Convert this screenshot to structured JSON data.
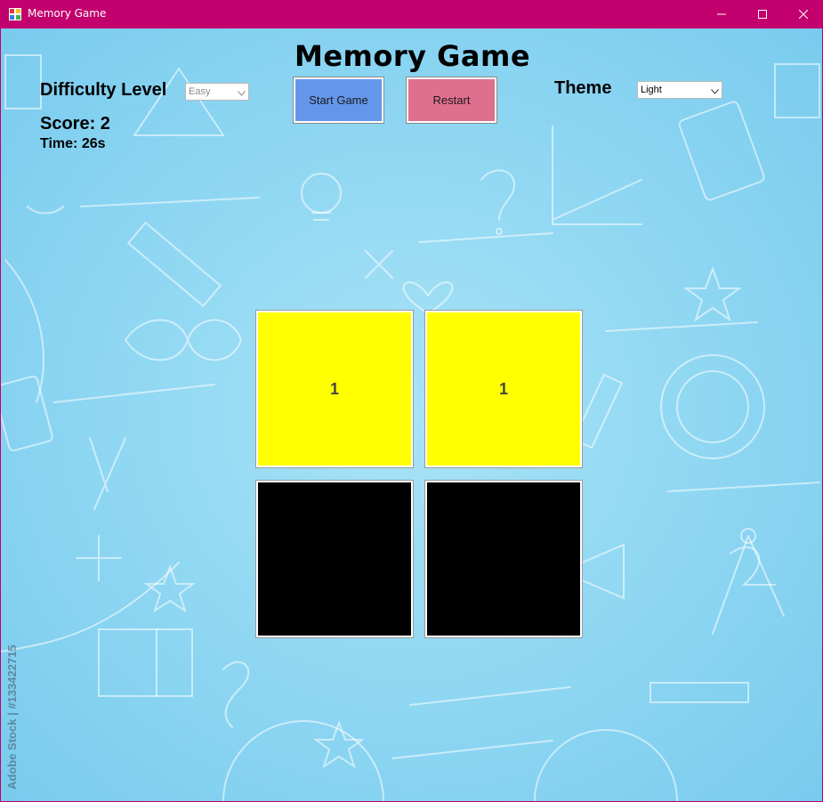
{
  "window": {
    "title": "Memory Game",
    "titlebar_color": "#c2006e",
    "icon": "app-grid-icon",
    "controls": [
      "minimize-icon",
      "maximize-icon",
      "close-icon"
    ]
  },
  "game": {
    "heading": "Memory Game",
    "difficulty_label": "Difficulty Level",
    "difficulty_value": "Easy",
    "score_text": "Score: 2",
    "time_text": "Time: 26s",
    "theme_label": "Theme",
    "theme_value": "Light",
    "start_button": "Start Game",
    "restart_button": "Restart",
    "start_color": "#6497ea",
    "restart_color": "#df6f8e"
  },
  "cards": [
    {
      "text": "1",
      "state": "revealed",
      "color": "#ffff00"
    },
    {
      "text": "1",
      "state": "revealed",
      "color": "#ffff00"
    },
    {
      "text": "",
      "state": "hidden",
      "color": "#000000"
    },
    {
      "text": "",
      "state": "hidden",
      "color": "#000000"
    }
  ],
  "background": {
    "watermark": "Adobe Stock | #133422715",
    "color": "#8dd6f2"
  }
}
